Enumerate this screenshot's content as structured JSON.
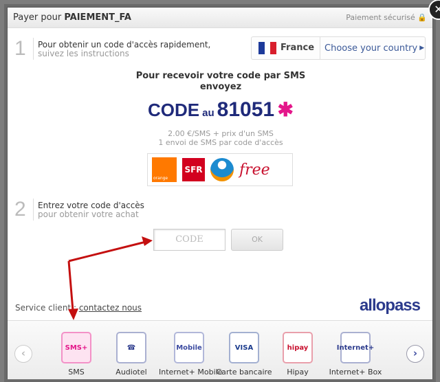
{
  "header": {
    "title_prefix": "Payer pour",
    "title_bold": "PAIEMENT_FA",
    "secure": "Paiement sécurisé"
  },
  "step1": {
    "num": "1",
    "line1": "Pour obtenir un code d'accès rapidement,",
    "line2": "suivez les instructions"
  },
  "country": {
    "name": "France",
    "choose": "Choose your country"
  },
  "sms": {
    "heading1": "Pour recevoir votre code par SMS",
    "heading2": "envoyez",
    "code": "CODE",
    "au": "au",
    "number": "81051",
    "price": "2.00 €/SMS + prix d'un SMS",
    "per": "1 envoi de SMS par code d'accès"
  },
  "operators": {
    "orange": "orange",
    "sfr": "SFR",
    "free": "free"
  },
  "step2": {
    "num": "2",
    "line1": "Entrez votre code d'accès",
    "line2": "pour obtenir votre achat"
  },
  "form": {
    "code_placeholder": "CODE",
    "ok": "OK"
  },
  "footer": {
    "service": "Service client :",
    "contact": "contactez nous",
    "brand": "allopass"
  },
  "methods": [
    {
      "label": "SMS",
      "icon_text": "SMS+",
      "color": "#e4168a"
    },
    {
      "label": "Audiotel",
      "icon_text": "☎",
      "color": "#2b3a8c"
    },
    {
      "label": "Internet+ Mobile",
      "icon_text": "Mobile",
      "color": "#3b4aa0"
    },
    {
      "label": "Carte bancaire",
      "icon_text": "VISA",
      "color": "#1a3a8c"
    },
    {
      "label": "Hipay",
      "icon_text": "hipay",
      "color": "#c8102e"
    },
    {
      "label": "Internet+ Box",
      "icon_text": "Internet+",
      "color": "#2b3a8c"
    }
  ]
}
